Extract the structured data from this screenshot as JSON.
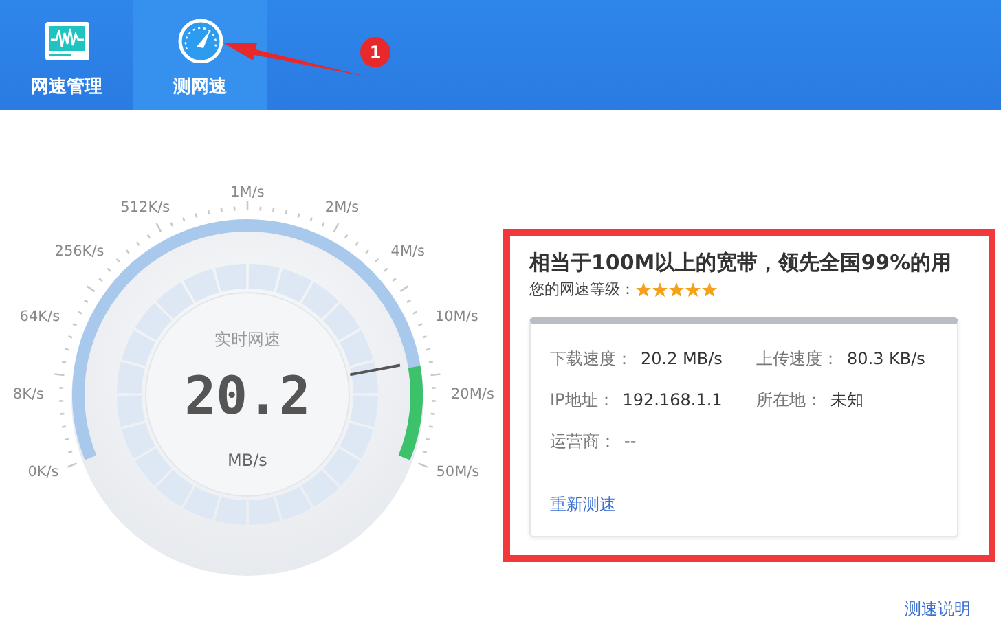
{
  "header": {
    "tabs": [
      {
        "label": "网速管理",
        "kind": "monitor",
        "selected": false
      },
      {
        "label": "测网速",
        "kind": "gauge",
        "selected": true
      }
    ]
  },
  "annotation": {
    "badge": "1"
  },
  "gauge": {
    "scale_labels": [
      "0K/s",
      "8K/s",
      "64K/s",
      "256K/s",
      "512K/s",
      "1M/s",
      "2M/s",
      "4M/s",
      "10M/s",
      "20M/s",
      "50M/s"
    ],
    "caption": "实时网速",
    "reading": "20.2",
    "unit": "MB/s",
    "level": 0.86
  },
  "result": {
    "headline": "相当于100M以上的宽带，领先全国99%的用",
    "rating_label": "您的网速等级：",
    "stars": 5,
    "details": [
      {
        "label": "下载速度：",
        "value": "20.2 MB/s"
      },
      {
        "label": "上传速度：",
        "value": "80.3 KB/s"
      },
      {
        "label": "IP地址：",
        "value": "192.168.1.1"
      },
      {
        "label": "所在地：",
        "value": "未知"
      },
      {
        "label": "运营商：",
        "value": "--"
      }
    ],
    "retest_link": "重新测速"
  },
  "help_link": "测速说明"
}
